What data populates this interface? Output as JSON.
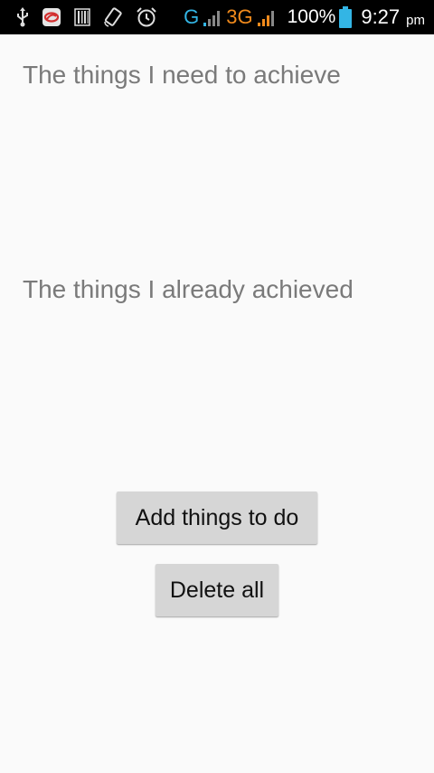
{
  "status_bar": {
    "network_g": "G",
    "network_3g": "3G",
    "battery_percent": "100%",
    "time": "9:27",
    "time_suffix": "pm",
    "icons": [
      "usb-icon",
      "app-notification-icon",
      "barcode-icon",
      "screen-rotate-icon",
      "alarm-icon",
      "signal-g-icon",
      "signal-3g-icon",
      "battery-icon"
    ]
  },
  "main": {
    "todo_heading": "The things I need to achieve",
    "done_heading": "The things I already achieved",
    "add_button_label": "Add things to do",
    "delete_button_label": "Delete all"
  },
  "colors": {
    "background": "#fafafa",
    "heading_text": "#7a7a7a",
    "button_bg": "#d6d6d6",
    "accent_blue": "#33b5e5",
    "accent_orange": "#f08a1c"
  }
}
